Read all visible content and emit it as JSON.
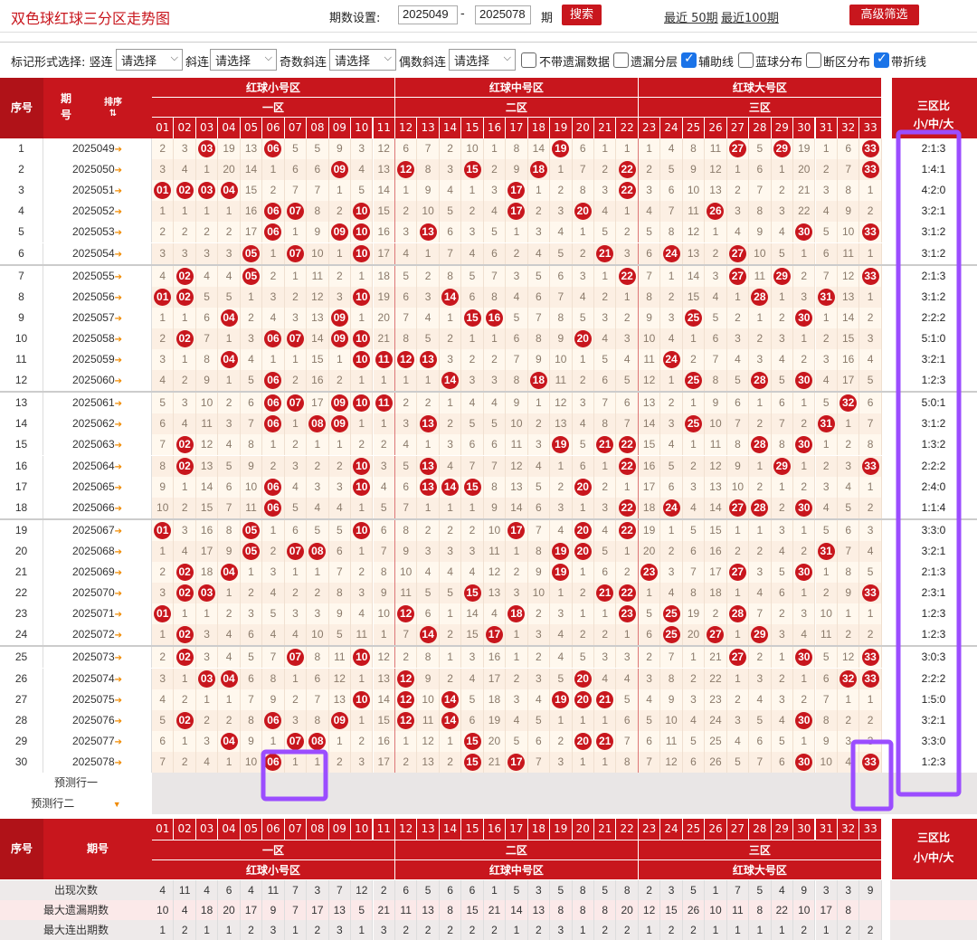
{
  "title": "双色球红球三分区走势图",
  "period": {
    "label": "期数设置:",
    "from": "2025049",
    "dash": "-",
    "to": "2025078",
    "unit": "期",
    "search": "搜索",
    "recent50": "最近 50期",
    "recent100": "最近100期",
    "advanced": "高级筛选"
  },
  "options": {
    "mark_label": "标记形式选择: 竖连",
    "select_placeholder": "请选择",
    "xielian": "斜连",
    "odd": "奇数斜连",
    "even": "偶数斜连",
    "no_miss": "不带遗漏数据",
    "miss_layer": "遗漏分层",
    "aux_line": "辅助线",
    "blue_dist": "蓝球分布",
    "break_dist": "断区分布",
    "fold_line": "带折线"
  },
  "header": {
    "seq": "序号",
    "issue": "期号",
    "sort": "排序",
    "small": "红球小号区",
    "mid": "红球中号区",
    "big": "红球大号区",
    "z1": "一区",
    "z2": "二区",
    "z3": "三区",
    "ratio_a": "三区比",
    "ratio_b": "小/中/大"
  },
  "numbers": [
    "01",
    "02",
    "03",
    "04",
    "05",
    "06",
    "07",
    "08",
    "09",
    "10",
    "11",
    "12",
    "13",
    "14",
    "15",
    "16",
    "17",
    "18",
    "19",
    "20",
    "21",
    "22",
    "23",
    "24",
    "25",
    "26",
    "27",
    "28",
    "29",
    "30",
    "31",
    "32",
    "33"
  ],
  "rows": [
    {
      "n": "1",
      "issue": "2025049",
      "c": [
        2,
        3,
        "03",
        19,
        13,
        "06",
        5,
        5,
        9,
        3,
        12,
        6,
        7,
        2,
        10,
        1,
        8,
        14,
        "19",
        6,
        1,
        1,
        1,
        4,
        8,
        11,
        "27",
        5,
        "29",
        19,
        1,
        6,
        "33"
      ],
      "ratio": "2:1:3"
    },
    {
      "n": "2",
      "issue": "2025050",
      "c": [
        3,
        4,
        1,
        20,
        14,
        1,
        6,
        6,
        "09",
        4,
        13,
        "12",
        8,
        3,
        "15",
        2,
        9,
        "18",
        1,
        7,
        2,
        "22",
        2,
        5,
        9,
        12,
        1,
        6,
        1,
        20,
        2,
        7,
        "33"
      ],
      "ratio": "1:4:1"
    },
    {
      "n": "3",
      "issue": "2025051",
      "c": [
        "01",
        "02",
        "03",
        "04",
        15,
        2,
        7,
        7,
        1,
        5,
        14,
        1,
        9,
        4,
        1,
        3,
        "17",
        1,
        2,
        8,
        3,
        "22",
        3,
        6,
        10,
        13,
        2,
        7,
        2,
        21,
        3,
        8,
        1
      ],
      "ratio": "4:2:0"
    },
    {
      "n": "4",
      "issue": "2025052",
      "c": [
        1,
        1,
        1,
        1,
        16,
        "06",
        "07",
        8,
        2,
        "10",
        15,
        2,
        10,
        5,
        2,
        4,
        "17",
        2,
        3,
        "20",
        4,
        1,
        4,
        7,
        11,
        "26",
        3,
        8,
        3,
        22,
        4,
        9,
        2
      ],
      "ratio": "3:2:1"
    },
    {
      "n": "5",
      "issue": "2025053",
      "c": [
        2,
        2,
        2,
        2,
        17,
        "06",
        1,
        9,
        "09",
        "10",
        16,
        3,
        "13",
        6,
        3,
        5,
        1,
        3,
        4,
        1,
        5,
        2,
        5,
        8,
        12,
        1,
        4,
        9,
        4,
        "30",
        5,
        10,
        "33"
      ],
      "ratio": "3:1:2"
    },
    {
      "n": "6",
      "issue": "2025054",
      "c": [
        3,
        3,
        3,
        3,
        "05",
        1,
        "07",
        10,
        1,
        "10",
        17,
        4,
        1,
        7,
        4,
        6,
        2,
        4,
        5,
        2,
        "21",
        3,
        6,
        "24",
        13,
        2,
        "27",
        10,
        5,
        1,
        6,
        11,
        1
      ],
      "ratio": "3:1:2"
    },
    {
      "n": "7",
      "issue": "2025055",
      "c": [
        4,
        "02",
        4,
        4,
        "05",
        2,
        1,
        11,
        2,
        1,
        18,
        5,
        2,
        8,
        5,
        7,
        3,
        5,
        6,
        3,
        1,
        "22",
        7,
        1,
        14,
        3,
        "27",
        11,
        "29",
        2,
        7,
        12,
        "33"
      ],
      "ratio": "2:1:3"
    },
    {
      "n": "8",
      "issue": "2025056",
      "c": [
        "01",
        "02",
        5,
        5,
        1,
        3,
        2,
        12,
        3,
        "10",
        19,
        6,
        3,
        "14",
        6,
        8,
        4,
        6,
        7,
        4,
        2,
        1,
        8,
        2,
        15,
        4,
        1,
        "28",
        1,
        3,
        "31",
        13,
        1
      ],
      "ratio": "3:1:2"
    },
    {
      "n": "9",
      "issue": "2025057",
      "c": [
        1,
        1,
        6,
        "04",
        2,
        4,
        3,
        13,
        "09",
        1,
        20,
        7,
        4,
        1,
        "15",
        "16",
        5,
        7,
        8,
        5,
        3,
        2,
        9,
        3,
        "25",
        5,
        2,
        1,
        2,
        "30",
        1,
        14,
        2
      ],
      "ratio": "2:2:2"
    },
    {
      "n": "10",
      "issue": "2025058",
      "c": [
        2,
        "02",
        7,
        1,
        3,
        "06",
        "07",
        14,
        "09",
        "10",
        21,
        8,
        5,
        2,
        1,
        1,
        6,
        8,
        9,
        "20",
        4,
        3,
        10,
        4,
        1,
        6,
        3,
        2,
        3,
        1,
        2,
        15,
        3
      ],
      "ratio": "5:1:0"
    },
    {
      "n": "11",
      "issue": "2025059",
      "c": [
        3,
        1,
        8,
        "04",
        4,
        1,
        1,
        15,
        1,
        "10",
        "11",
        "12",
        "13",
        3,
        2,
        2,
        7,
        9,
        10,
        1,
        5,
        4,
        11,
        "24",
        2,
        7,
        4,
        3,
        4,
        2,
        3,
        16,
        4
      ],
      "ratio": "3:2:1"
    },
    {
      "n": "12",
      "issue": "2025060",
      "c": [
        4,
        2,
        9,
        1,
        5,
        "06",
        2,
        16,
        2,
        1,
        1,
        1,
        1,
        "14",
        3,
        3,
        8,
        "18",
        11,
        2,
        6,
        5,
        12,
        1,
        "25",
        8,
        5,
        "28",
        5,
        "30",
        4,
        17,
        5
      ],
      "ratio": "1:2:3"
    },
    {
      "n": "13",
      "issue": "2025061",
      "c": [
        5,
        3,
        10,
        2,
        6,
        "06",
        "07",
        17,
        "09",
        "10",
        "11",
        2,
        2,
        1,
        4,
        4,
        9,
        1,
        12,
        3,
        7,
        6,
        13,
        2,
        1,
        9,
        6,
        1,
        6,
        1,
        5,
        "32",
        6
      ],
      "ratio": "5:0:1"
    },
    {
      "n": "14",
      "issue": "2025062",
      "c": [
        6,
        4,
        11,
        3,
        7,
        "06",
        1,
        "08",
        "09",
        1,
        1,
        3,
        "13",
        2,
        5,
        5,
        10,
        2,
        13,
        4,
        8,
        7,
        14,
        3,
        "25",
        10,
        7,
        2,
        7,
        2,
        "31",
        1,
        7
      ],
      "ratio": "3:1:2"
    },
    {
      "n": "15",
      "issue": "2025063",
      "c": [
        7,
        "02",
        12,
        4,
        8,
        1,
        2,
        1,
        1,
        2,
        2,
        4,
        1,
        3,
        6,
        6,
        11,
        3,
        "19",
        5,
        "21",
        "22",
        15,
        4,
        1,
        11,
        8,
        "28",
        8,
        "30",
        1,
        2,
        8
      ],
      "ratio": "1:3:2"
    },
    {
      "n": "16",
      "issue": "2025064",
      "c": [
        8,
        "02",
        13,
        5,
        9,
        2,
        3,
        2,
        2,
        "10",
        3,
        5,
        "13",
        4,
        7,
        7,
        12,
        4,
        1,
        6,
        1,
        "22",
        16,
        5,
        2,
        12,
        9,
        1,
        "29",
        1,
        2,
        3,
        "33"
      ],
      "ratio": "2:2:2"
    },
    {
      "n": "17",
      "issue": "2025065",
      "c": [
        9,
        1,
        14,
        6,
        10,
        "06",
        4,
        3,
        3,
        "10",
        4,
        6,
        "13",
        "14",
        "15",
        8,
        13,
        5,
        2,
        "20",
        2,
        1,
        17,
        6,
        3,
        13,
        10,
        2,
        1,
        2,
        3,
        4,
        1
      ],
      "ratio": "2:4:0"
    },
    {
      "n": "18",
      "issue": "2025066",
      "c": [
        10,
        2,
        15,
        7,
        11,
        "06",
        5,
        4,
        4,
        1,
        5,
        7,
        1,
        1,
        1,
        9,
        14,
        6,
        3,
        1,
        3,
        "22",
        18,
        "24",
        4,
        14,
        "27",
        "28",
        2,
        "30",
        4,
        5,
        2
      ],
      "ratio": "1:1:4"
    },
    {
      "n": "19",
      "issue": "2025067",
      "c": [
        "01",
        3,
        16,
        8,
        "05",
        1,
        6,
        5,
        5,
        "10",
        6,
        8,
        2,
        2,
        2,
        10,
        "17",
        7,
        4,
        "20",
        4,
        "22",
        19,
        1,
        5,
        15,
        1,
        1,
        3,
        1,
        5,
        6,
        3
      ],
      "ratio": "3:3:0"
    },
    {
      "n": "20",
      "issue": "2025068",
      "c": [
        1,
        4,
        17,
        9,
        "05",
        2,
        "07",
        "08",
        6,
        1,
        7,
        9,
        3,
        3,
        3,
        11,
        1,
        8,
        "19",
        "20",
        5,
        1,
        20,
        2,
        6,
        16,
        2,
        2,
        4,
        2,
        "31",
        7,
        4
      ],
      "ratio": "3:2:1"
    },
    {
      "n": "21",
      "issue": "2025069",
      "c": [
        2,
        "02",
        18,
        "04",
        1,
        3,
        1,
        1,
        7,
        2,
        8,
        10,
        4,
        4,
        4,
        12,
        2,
        9,
        "19",
        1,
        6,
        2,
        "23",
        3,
        7,
        17,
        "27",
        3,
        5,
        "30",
        1,
        8,
        5
      ],
      "ratio": "2:1:3"
    },
    {
      "n": "22",
      "issue": "2025070",
      "c": [
        3,
        "02",
        "03",
        1,
        2,
        4,
        2,
        2,
        8,
        3,
        9,
        11,
        5,
        5,
        "15",
        13,
        3,
        10,
        1,
        2,
        "21",
        "22",
        1,
        4,
        8,
        18,
        1,
        4,
        6,
        1,
        2,
        9,
        "33"
      ],
      "ratio": "2:3:1"
    },
    {
      "n": "23",
      "issue": "2025071",
      "c": [
        "01",
        1,
        1,
        2,
        3,
        5,
        3,
        3,
        9,
        4,
        10,
        "12",
        6,
        1,
        14,
        4,
        "18",
        2,
        3,
        1,
        1,
        "23",
        5,
        "25",
        19,
        2,
        "28",
        7,
        2,
        3,
        10,
        1,
        1
      ],
      "ratio": "1:2:3"
    },
    {
      "n": "24",
      "issue": "2025072",
      "c": [
        1,
        "02",
        3,
        4,
        6,
        4,
        4,
        10,
        5,
        11,
        1,
        7,
        "14",
        2,
        15,
        "17",
        1,
        3,
        4,
        2,
        2,
        1,
        6,
        "25",
        20,
        "27",
        1,
        "29",
        3,
        4,
        11,
        2,
        2
      ],
      "ratio": "1:2:3"
    },
    {
      "n": "25",
      "issue": "2025073",
      "c": [
        2,
        "02",
        3,
        4,
        5,
        7,
        "07",
        8,
        11,
        "10",
        12,
        2,
        8,
        1,
        3,
        16,
        1,
        2,
        4,
        5,
        3,
        3,
        2,
        7,
        1,
        21,
        "27",
        2,
        1,
        "30",
        5,
        12,
        "33"
      ],
      "ratio": "3:0:3"
    },
    {
      "n": "26",
      "issue": "2025074",
      "c": [
        3,
        1,
        "03",
        "04",
        6,
        8,
        1,
        6,
        12,
        1,
        13,
        "12",
        9,
        2,
        4,
        17,
        2,
        3,
        5,
        "20",
        4,
        4,
        3,
        8,
        2,
        22,
        1,
        3,
        2,
        1,
        6,
        "32",
        "33"
      ],
      "ratio": "2:2:2"
    },
    {
      "n": "27",
      "issue": "2025075",
      "c": [
        4,
        2,
        1,
        1,
        7,
        9,
        2,
        7,
        13,
        "10",
        14,
        "12",
        10,
        "14",
        5,
        18,
        3,
        4,
        "19",
        "20",
        "21",
        5,
        4,
        9,
        3,
        23,
        2,
        4,
        3,
        2,
        7,
        1,
        1
      ],
      "ratio": "1:5:0"
    },
    {
      "n": "28",
      "issue": "2025076",
      "c": [
        5,
        "02",
        2,
        2,
        8,
        "06",
        3,
        8,
        "09",
        1,
        15,
        "12",
        11,
        "14",
        6,
        19,
        4,
        5,
        1,
        1,
        1,
        6,
        5,
        10,
        4,
        24,
        3,
        5,
        4,
        "30",
        8,
        2,
        2
      ],
      "ratio": "3:2:1"
    },
    {
      "n": "29",
      "issue": "2025077",
      "c": [
        6,
        1,
        3,
        "04",
        9,
        1,
        "07",
        "08",
        1,
        2,
        16,
        1,
        12,
        1,
        "15",
        20,
        5,
        6,
        2,
        "20",
        "21",
        7,
        6,
        11,
        5,
        25,
        4,
        6,
        5,
        1,
        9,
        3,
        3
      ],
      "ratio": "3:3:0"
    },
    {
      "n": "30",
      "issue": "2025078",
      "c": [
        7,
        2,
        4,
        1,
        10,
        "06",
        1,
        1,
        2,
        3,
        17,
        2,
        13,
        2,
        "15",
        21,
        "17",
        7,
        3,
        1,
        1,
        8,
        7,
        12,
        6,
        26,
        5,
        7,
        6,
        "30",
        10,
        4,
        "33"
      ],
      "ratio": "1:2:3"
    }
  ],
  "predict1": "预测行一",
  "predict2": "预测行二",
  "stats": [
    {
      "label": "出现次数",
      "v": [
        4,
        11,
        4,
        6,
        4,
        11,
        7,
        3,
        7,
        12,
        2,
        6,
        5,
        6,
        6,
        1,
        5,
        3,
        5,
        8,
        5,
        8,
        2,
        3,
        5,
        1,
        7,
        5,
        4,
        9,
        3,
        3,
        9
      ]
    },
    {
      "label": "最大遗漏期数",
      "v": [
        10,
        4,
        18,
        20,
        17,
        9,
        7,
        17,
        13,
        5,
        21,
        11,
        13,
        8,
        15,
        21,
        14,
        13,
        8,
        8,
        8,
        20,
        12,
        15,
        26,
        10,
        11,
        8,
        22,
        10,
        17,
        8,
        ""
      ]
    },
    {
      "label": "最大连出期数",
      "v": [
        1,
        2,
        1,
        1,
        2,
        3,
        1,
        2,
        3,
        1,
        3,
        2,
        2,
        2,
        2,
        2,
        1,
        2,
        3,
        1,
        2,
        2,
        1,
        2,
        2,
        1,
        1,
        1,
        1,
        2,
        1,
        2,
        2
      ]
    }
  ],
  "colors": {
    "accent": "#c8161d",
    "grid": "#fbeee0",
    "outline": "#9b4dff"
  }
}
